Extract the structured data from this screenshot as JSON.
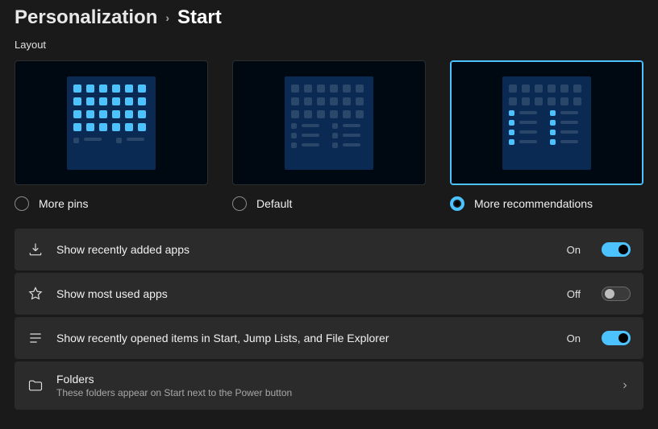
{
  "breadcrumb": {
    "parent": "Personalization",
    "current": "Start"
  },
  "section_label": "Layout",
  "layout_options": [
    {
      "id": "more-pins",
      "label": "More pins",
      "selected": false
    },
    {
      "id": "default",
      "label": "Default",
      "selected": false
    },
    {
      "id": "more-recommendations",
      "label": "More recommendations",
      "selected": true
    }
  ],
  "settings": [
    {
      "id": "recently-added",
      "icon": "download-icon",
      "title": "Show recently added apps",
      "toggle": true,
      "state_label": "On"
    },
    {
      "id": "most-used",
      "icon": "star-icon",
      "title": "Show most used apps",
      "toggle": false,
      "state_label": "Off"
    },
    {
      "id": "recently-opened",
      "icon": "list-icon",
      "title": "Show recently opened items in Start, Jump Lists, and File Explorer",
      "toggle": true,
      "state_label": "On"
    },
    {
      "id": "folders",
      "icon": "folder-icon",
      "title": "Folders",
      "subtitle": "These folders appear on Start next to the Power button",
      "nav": true
    }
  ],
  "colors": {
    "accent": "#4cc2ff",
    "card_bg": "#2b2b2b",
    "page_bg": "#1a1a1a"
  }
}
